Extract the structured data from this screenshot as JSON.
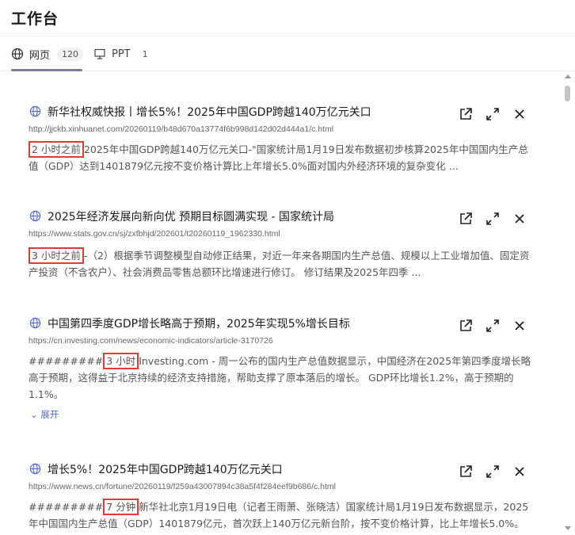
{
  "header": {
    "title": "工作台"
  },
  "tabs": [
    {
      "label": "网页",
      "count": "120",
      "icon": "globe-icon",
      "active": true
    },
    {
      "label": "PPT",
      "count": "1",
      "icon": "presentation-icon",
      "active": false
    }
  ],
  "results": [
    {
      "title": "新华社权威快报丨增长5%！2025年中国GDP跨越140万亿元关口",
      "url": "http://jjckb.xinhuanet.com/20260119/b48d670a13774f6b998d142d02d444a1/c.html",
      "time": "2 小时之前",
      "pre": "",
      "snippet": "2025年中国GDP跨越140万亿元关口-\"国家统计局1月19日发布数据初步核算2025年中国国内生产总值（GDP）达到1401879亿元按不变价格计算比上年增长5.0%面对国内外经济环境的复杂变化 ..."
    },
    {
      "title": "2025年经济发展向新向优 预期目标圆满实现 - 国家统计局",
      "url": "https://www.stats.gov.cn/sj/zxfbhjd/202601/t20260119_1962330.html",
      "time": "3 小时之前",
      "pre": "",
      "snippet": "-（2）根据季节调整模型自动修正结果，对近一年来各期国内生产总值、规模以上工业增加值、固定资产投资（不含农户）、社会消费品零售总额环比增速进行修订。 修订结果及2025年四季 ..."
    },
    {
      "title": "中国第四季度GDP增长略高于预期，2025年实现5%增长目标",
      "url": "https://cn.investing.com/news/economic-indicators/article-3170726",
      "time": "3 小时",
      "pre": "#########",
      "snippet": "Investing.com - 周一公布的国内生产总值数据显示，中国经济在2025年第四季度增长略高于预期，这得益于北京持续的经济支持措施，帮助支撑了原本落后的增长。 GDP环比增长1.2%，高于预期的1.1%。",
      "expand_label": "展开"
    },
    {
      "title": "增长5%！2025年中国GDP跨越140万亿元关口",
      "url": "https://www.news.cn/fortune/20260119/f259a43007894c38a5f4f284eef9b686/c.html",
      "time": "7 分钟",
      "pre": "#########",
      "snippet": "新华社北京1月19日电（记者王雨萧、张晓洁）国家统计局1月19日发布数据显示，2025年中国国内生产总值（GDP）1401879亿元，首次跃上140万亿元新台阶，按不变价格计算，比上年增长5.0%。"
    }
  ],
  "icons": {
    "open": "external-link-icon",
    "fullscreen": "expand-icon",
    "close": "close-icon"
  },
  "colors": {
    "highlight_border": "#e53935",
    "tab_underline": "#7b7e92",
    "expand_link": "#5a6bbf"
  }
}
